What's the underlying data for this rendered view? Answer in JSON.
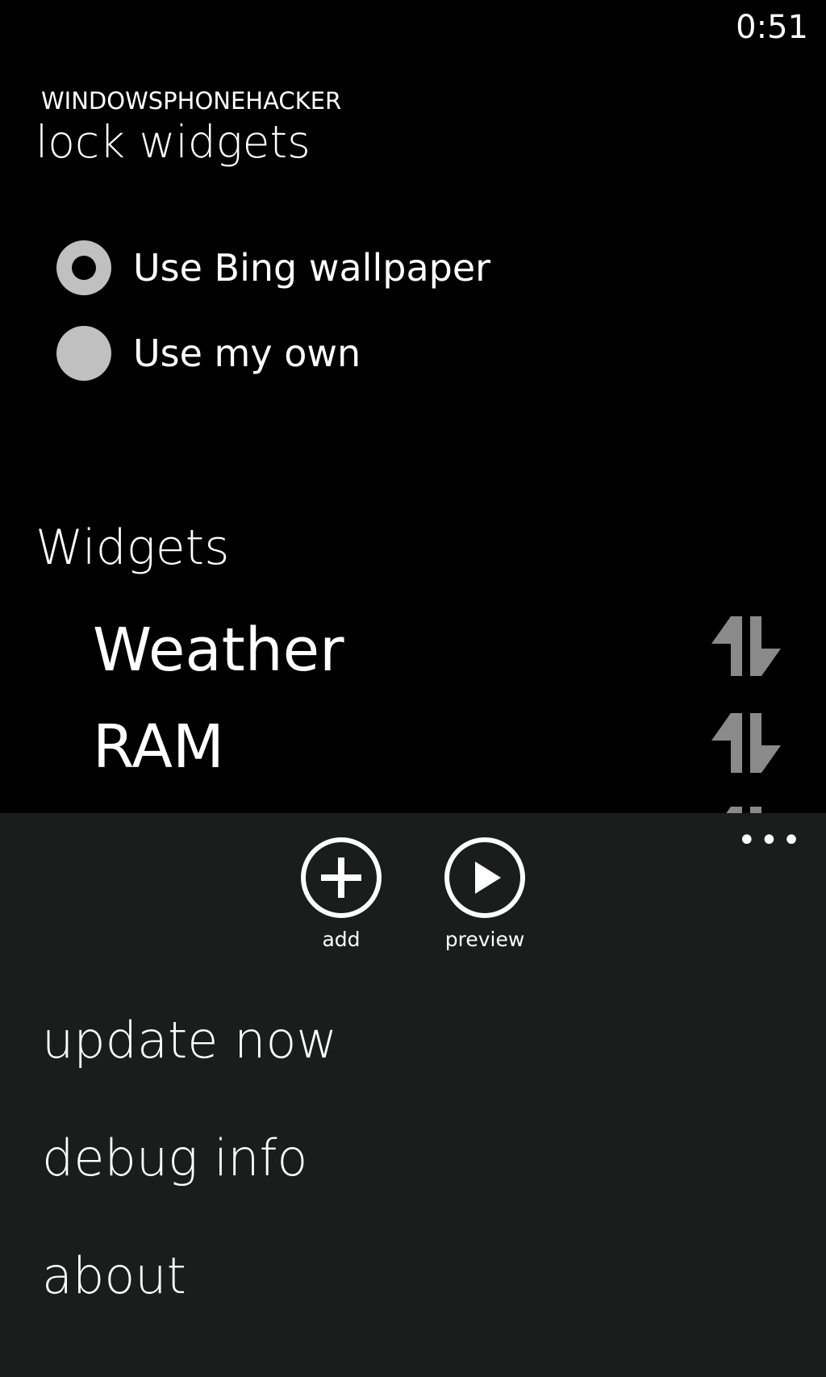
{
  "status_bar": {
    "time": "0:51"
  },
  "header": {
    "app_name": "WINDOWSPHONEHACKER",
    "page_title": "lock widgets"
  },
  "wallpaper_options": [
    {
      "label": "Use Bing wallpaper",
      "selected": true
    },
    {
      "label": "Use my own",
      "selected": false
    }
  ],
  "widgets_section": {
    "title": "Widgets",
    "items": [
      {
        "label": "Weather",
        "icon": "reorder-icon"
      },
      {
        "label": "RAM",
        "icon": "reorder-icon"
      }
    ]
  },
  "app_bar": {
    "background": "#1a1d1b",
    "more_icon": "ellipsis-icon",
    "buttons": [
      {
        "label": "add",
        "icon": "add-circle-icon"
      },
      {
        "label": "preview",
        "icon": "play-circle-icon"
      }
    ],
    "menu_items": [
      {
        "label": "update now"
      },
      {
        "label": "debug info"
      },
      {
        "label": "about"
      }
    ]
  },
  "colors": {
    "background": "#000000",
    "radio_fill": "#c0c0c0",
    "reorder_icon": "#8a8a8a",
    "text": "#ffffff"
  }
}
